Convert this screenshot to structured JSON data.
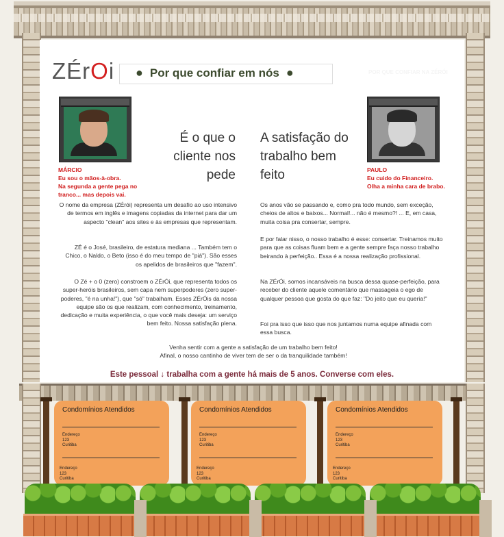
{
  "brand": {
    "logo_text_a": "ZÉr",
    "logo_text_o": "O",
    "logo_text_b": "i"
  },
  "header": {
    "title": "Por que confiar em nós",
    "faded_text": "POR QUE CONFIAR NA ZÉRÓI"
  },
  "people": {
    "marcio": {
      "name": "MÁRCIO",
      "line1": "Eu sou o mãos-à-obra.",
      "line2": "Na segunda a gente pega no tranco... mas depois vai."
    },
    "paulo": {
      "name": "PAULO",
      "line1": "Eu cuido do Financeiro.",
      "line2": "Olha a minha cara de brabo."
    }
  },
  "headings": {
    "left": "É o que o cliente nos pede",
    "right": "A satisfação do trabalho bem feito"
  },
  "left_text": {
    "p1": "O nome da empresa (ZÉrói) representa um desafio ao uso intensivo de termos em inglês e imagens copiadas da internet para dar um aspecto \"clean\" aos sites e às empresas que representam.",
    "p2": "ZÉ é o José,  brasileiro, de estatura mediana ... Também tem o Chico, o Naldo, o Beto (isso é do meu tempo de \"piá\"). São esses os apelidos de brasileiros que \"fazem\".",
    "p3": "O Zé + o 0 (zero) constroem o ZÉrÓi, que representa todos os super-heróis brasileiros, sem capa nem superpoderes (zero super-poderes, \"é na unha!\"), que \"só\" trabalham. Esses ZÉrÓis  da nossa equipe são os que realizam, com conhecimento, treinamento, dedicação e muita experiência, o que você mais deseja: um serviço bem feito. Nossa satisfação plena."
  },
  "right_text": {
    "p1": "Os anos vão se passando e, como pra todo mundo, sem exceção, cheios de altos e baixos... Normal!... não é mesmo?! ... E, em casa, muita coisa pra consertar, sempre.",
    "p2": "E por falar nisso, o nosso trabalho é esse: consertar. Treinamos muito para que as coisas fluam bem e a gente sempre faça nosso trabalho beirando à perfeição.. Essa é a nossa realização profissional.",
    "p3": "Na ZÉrÓi, somos incansáveis na busca dessa quase-perfeição, para receber do cliente aquele comentário que massageia o ego de qualquer pessoa que gosta do que faz: \"Do jeito que eu queria!\"",
    "p4": "Foi pra isso que isso que nos juntamos numa equipe afinada com essa busca."
  },
  "closing": {
    "line1": "Venha sentir com a gente a satisfação de um trabalho bem feito!",
    "line2": "Afinal, o nosso cantinho de viver tem de ser o da tranquilidade também!"
  },
  "cta": "Este pessoal ↓ trabalha com a gente há mais de 5 anos. Converse com eles.",
  "cards": [
    {
      "title": "Condomínios Atendidos",
      "addr1": [
        "Endereço",
        "123",
        "Curitiba"
      ],
      "addr2": [
        "Endereço",
        "123",
        "Curitiba"
      ]
    },
    {
      "title": "Condomínios Atendidos",
      "addr1": [
        "Endereço",
        "123",
        "Curitiba"
      ],
      "addr2": [
        "Endereço",
        "123",
        "Curitiba"
      ]
    },
    {
      "title": "Condomínios Atendidos",
      "addr1": [
        "Endereço",
        "123",
        "Curitiba"
      ],
      "addr2": [
        "Endereço",
        "123",
        "Curitiba"
      ]
    }
  ]
}
